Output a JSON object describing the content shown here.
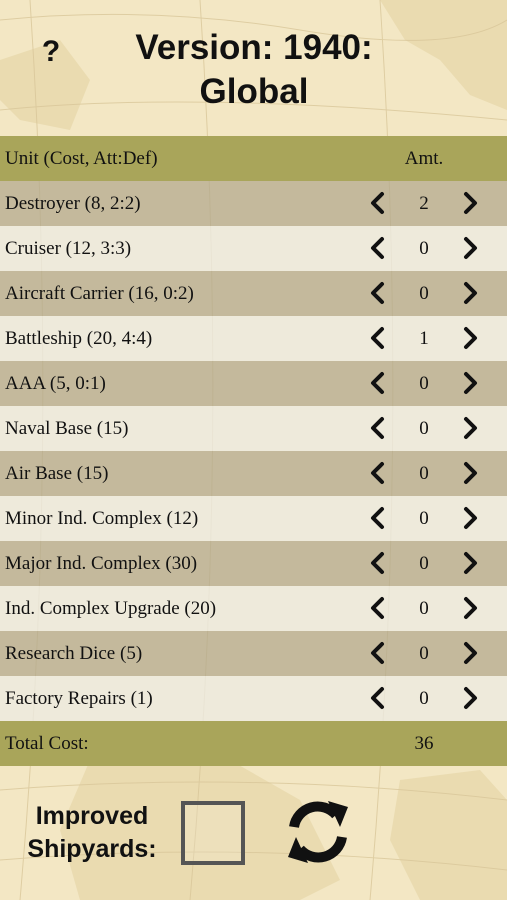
{
  "header": {
    "help_label": "?",
    "title": "Version: 1940: Global"
  },
  "table": {
    "col_unit": "Unit (Cost, Att:Def)",
    "col_amt": "Amt.",
    "rows": [
      {
        "unit": "Destroyer (8, 2:2)",
        "qty": "2"
      },
      {
        "unit": "Cruiser (12, 3:3)",
        "qty": "0"
      },
      {
        "unit": "Aircraft Carrier (16, 0:2)",
        "qty": "0"
      },
      {
        "unit": "Battleship (20, 4:4)",
        "qty": "1"
      },
      {
        "unit": "AAA (5, 0:1)",
        "qty": "0"
      },
      {
        "unit": "Naval Base (15)",
        "qty": "0"
      },
      {
        "unit": "Air Base (15)",
        "qty": "0"
      },
      {
        "unit": "Minor Ind. Complex (12)",
        "qty": "0"
      },
      {
        "unit": "Major Ind. Complex (30)",
        "qty": "0"
      },
      {
        "unit": "Ind. Complex Upgrade (20)",
        "qty": "0"
      },
      {
        "unit": "Research Dice (5)",
        "qty": "0"
      },
      {
        "unit": "Factory Repairs (1)",
        "qty": "0"
      }
    ],
    "total_label": "Total Cost:",
    "total_value": "36"
  },
  "footer": {
    "improved_shipyards_label": "Improved Shipyards:",
    "improved_shipyards_checked": false,
    "reset_icon": "refresh-icon"
  },
  "colors": {
    "header_bar": "#a9a55a",
    "row_dark": "#b2a88c",
    "row_light": "#eceae2",
    "background": "#f3e7c4"
  }
}
